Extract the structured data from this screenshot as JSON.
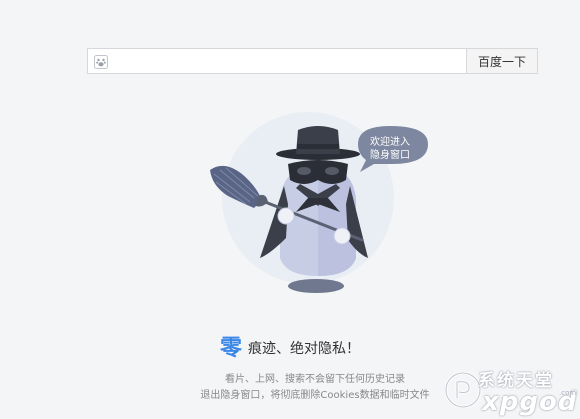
{
  "search": {
    "value": "",
    "button_label": "百度一下",
    "icon": "paw-icon"
  },
  "mascot": {
    "bubble_line1": "欢迎进入",
    "bubble_line2": "隐身窗口"
  },
  "headline": {
    "zero": "零",
    "rest": "痕迹、绝对隐私！"
  },
  "description": {
    "line1": "看片、上网、搜索不会留下任何历史记录",
    "line2": "退出隐身窗口，将彻底删除Cookies数据和临时文件"
  },
  "watermark": {
    "cn": "系统天堂",
    "en": "xpgod",
    "suffix": ".com"
  },
  "colors": {
    "accent": "#3a87e8",
    "bubble": "#7d879f",
    "background": "#f4f5f7"
  }
}
